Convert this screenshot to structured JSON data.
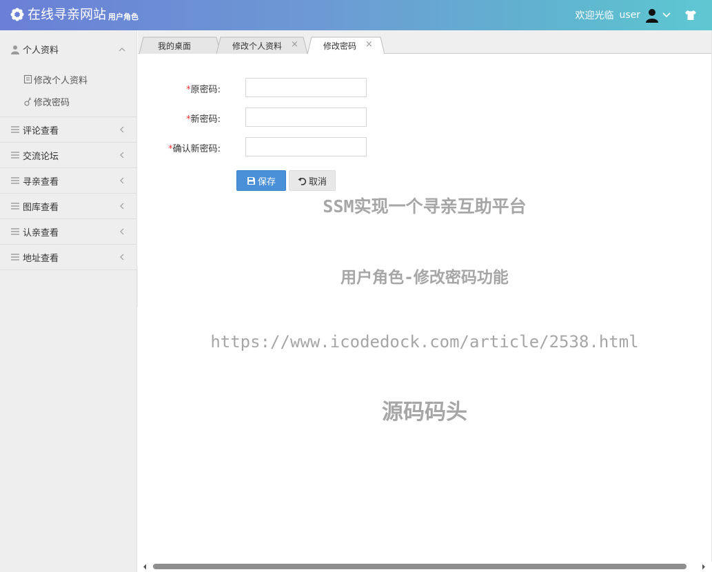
{
  "header": {
    "site_title": "在线寻亲网站",
    "role_label": "用户角色",
    "welcome_text": "欢迎光临",
    "username": "user"
  },
  "sidebar": {
    "items": [
      {
        "label": "个人资料",
        "icon": "user-icon",
        "open": true,
        "children": [
          {
            "label": "修改个人资料",
            "icon": "edit-icon"
          },
          {
            "label": "修改密码",
            "icon": "key-icon"
          }
        ]
      },
      {
        "label": "评论查看",
        "icon": "list-icon"
      },
      {
        "label": "交流论坛",
        "icon": "list-icon"
      },
      {
        "label": "寻亲查看",
        "icon": "list-icon"
      },
      {
        "label": "图库查看",
        "icon": "list-icon"
      },
      {
        "label": "认亲查看",
        "icon": "list-icon"
      },
      {
        "label": "地址查看",
        "icon": "list-icon"
      }
    ]
  },
  "tabs": [
    {
      "label": "我的桌面",
      "closable": false,
      "active": false
    },
    {
      "label": "修改个人资料",
      "closable": true,
      "active": false
    },
    {
      "label": "修改密码",
      "closable": true,
      "active": true
    }
  ],
  "tab_close_glyph": "×",
  "form": {
    "required_mark": "*",
    "fields": [
      {
        "label": "原密码:",
        "value": ""
      },
      {
        "label": "新密码:",
        "value": ""
      },
      {
        "label": "确认新密码:",
        "value": ""
      }
    ],
    "save_label": "保存",
    "cancel_label": "取消"
  },
  "watermarks": {
    "line1": "SSM实现一个寻亲互助平台",
    "line2": "用户角色-修改密码功能",
    "line3": "https://www.icodedock.com/article/2538.html",
    "line4": "源码码头"
  },
  "colors": {
    "header_gradient_start": "#6a7fd6",
    "header_gradient_end": "#5ec8d2",
    "primary_button": "#4a90d9",
    "required": "#e33333",
    "sidebar_bg": "#eeeeee"
  }
}
